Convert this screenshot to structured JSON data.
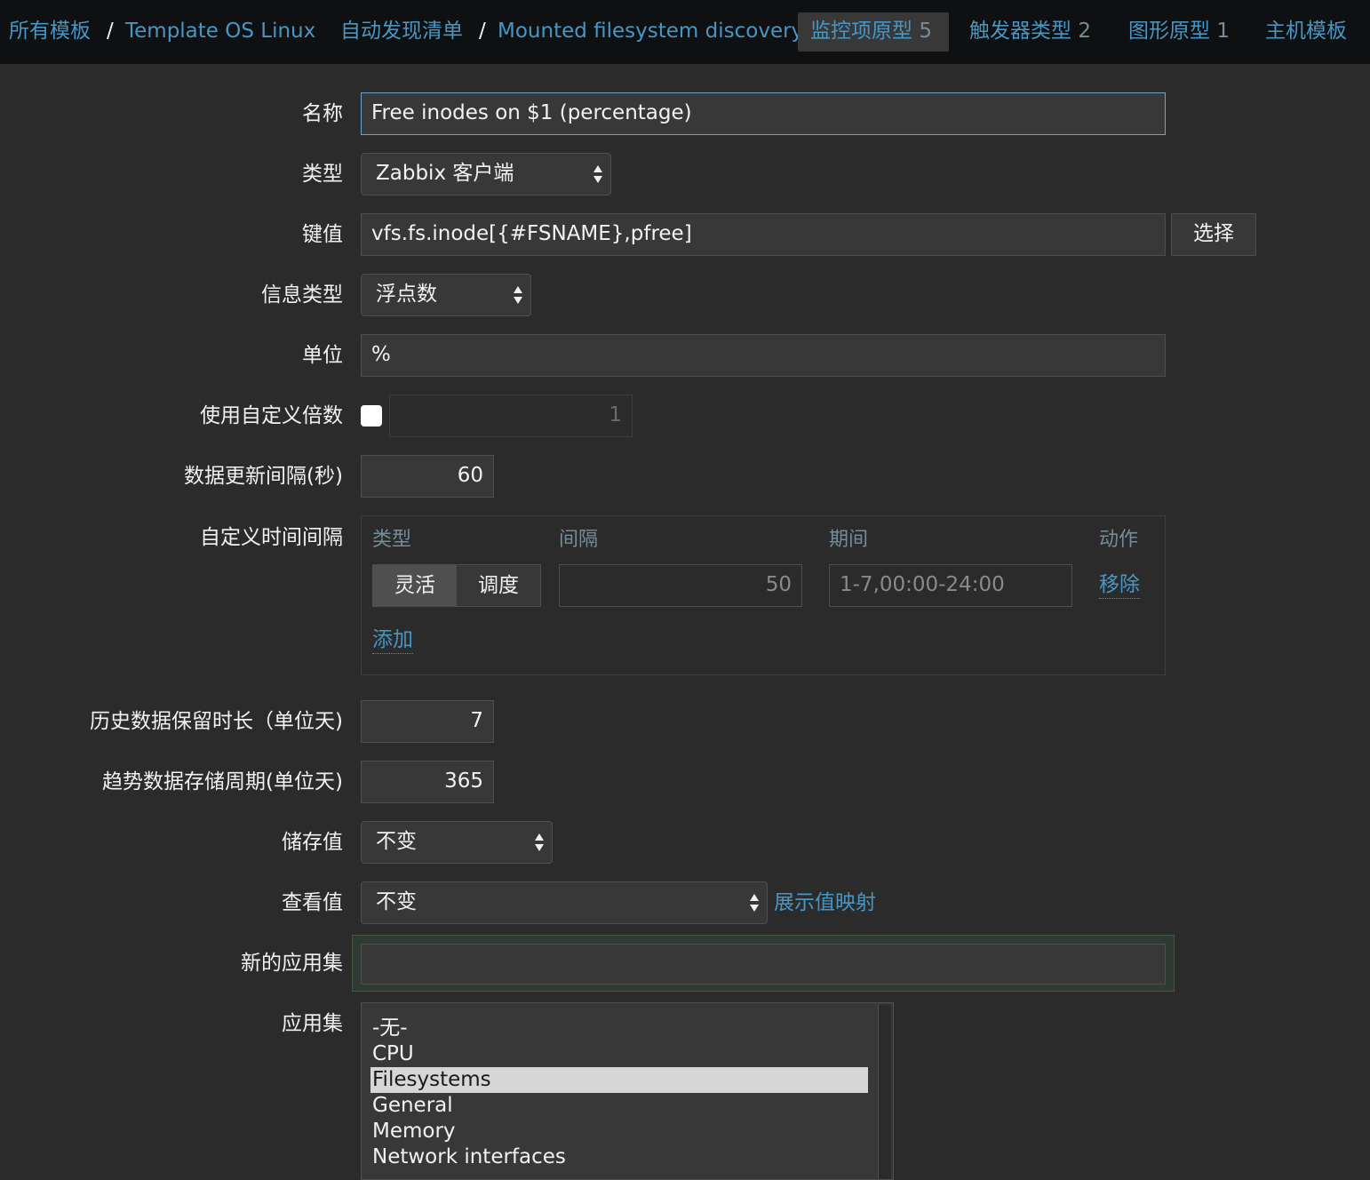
{
  "breadcrumbs": {
    "all_templates": "所有模板",
    "sep1": "/",
    "template": "Template OS Linux",
    "discovery_list": "自动发现清单",
    "sep2": "/",
    "discovery_rule": "Mounted filesystem discovery"
  },
  "tabs": [
    {
      "label": "监控项原型",
      "count": "5",
      "active": true
    },
    {
      "label": "触发器类型",
      "count": "2",
      "active": false
    },
    {
      "label": "图形原型",
      "count": "1",
      "active": false
    },
    {
      "label": "主机模板",
      "count": "",
      "active": false
    }
  ],
  "form": {
    "name": {
      "label": "名称",
      "value": "Free inodes on $1 (percentage)"
    },
    "type": {
      "label": "类型",
      "value": "Zabbix 客户端"
    },
    "key": {
      "label": "键值",
      "value": "vfs.fs.inode[{#FSNAME},pfree]",
      "button": "选择"
    },
    "value_type": {
      "label": "信息类型",
      "value": "浮点数"
    },
    "units": {
      "label": "单位",
      "value": "%"
    },
    "multiplier": {
      "label": "使用自定义倍数",
      "checked": false,
      "value": "1"
    },
    "delay": {
      "label": "数据更新间隔(秒)",
      "value": "60"
    },
    "custom_intervals": {
      "label": "自定义时间间隔",
      "headers": {
        "type": "类型",
        "interval": "间隔",
        "period": "期间",
        "action": "动作"
      },
      "row": {
        "type_flexible": "灵活",
        "type_scheduling": "调度",
        "interval": "50",
        "period": "1-7,00:00-24:00",
        "remove": "移除"
      },
      "add": "添加"
    },
    "history": {
      "label": "历史数据保留时长（单位天)",
      "value": "7"
    },
    "trends": {
      "label": "趋势数据存储周期(单位天)",
      "value": "365"
    },
    "store_value": {
      "label": "储存值",
      "value": "不变"
    },
    "show_value": {
      "label": "查看值",
      "value": "不变",
      "link": "展示值映射"
    },
    "new_application": {
      "label": "新的应用集",
      "value": ""
    },
    "applications": {
      "label": "应用集",
      "options": [
        "-无-",
        "CPU",
        "Filesystems",
        "General",
        "Memory",
        "Network interfaces"
      ],
      "selected": "Filesystems"
    }
  },
  "colors": {
    "link": "#4796c4",
    "background": "#2b2b2b",
    "topbar": "#0e1012",
    "field": "#383838"
  }
}
